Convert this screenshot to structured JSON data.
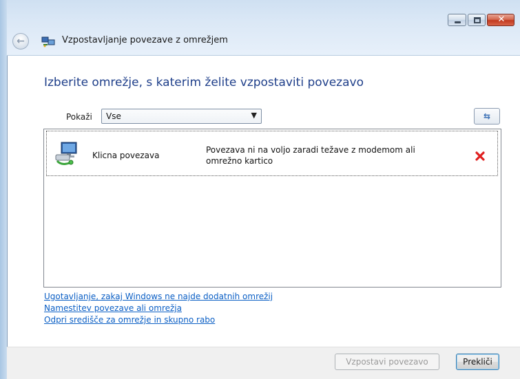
{
  "window": {
    "title": "Vzpostavljanje povezave z omrežjem",
    "close_glyph": "✕"
  },
  "heading": "Izberite omrežje, s katerim želite vzpostaviti povezavo",
  "filter": {
    "label": "Pokaži",
    "selected": "Vse"
  },
  "networks": [
    {
      "name": "Klicna povezava",
      "status_line1": "Povezava ni na voljo zaradi težave z modemom ali",
      "status_line2": "omrežno kartico"
    }
  ],
  "links": [
    "Ugotavljanje, zakaj Windows ne najde dodatnih omrežij",
    "Namestitev povezave ali omrežja",
    "Odpri središče za omrežje in skupno rabo"
  ],
  "buttons": {
    "connect": "Vzpostavi povezavo",
    "cancel": "Prekliči"
  },
  "colors": {
    "heading": "#1f3f8a",
    "link": "#0b5fc5",
    "error_x": "#e02020"
  }
}
